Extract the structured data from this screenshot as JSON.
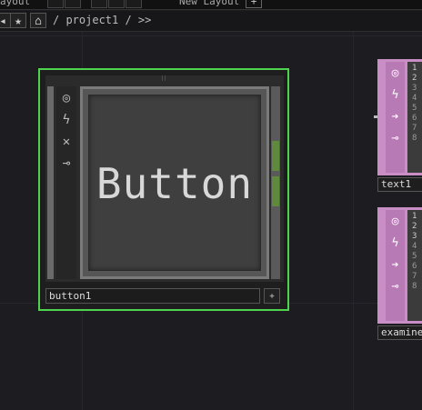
{
  "topbar": {
    "left_label": "ayout",
    "right_label": "New Layout",
    "add_label": "+"
  },
  "pathbar": {
    "back_glyph": "◂",
    "star_glyph": "★",
    "home_glyph": "⌂",
    "path": "/ project1 / >>"
  },
  "node_main": {
    "display_text": "Button",
    "name": "button1",
    "icons": [
      "viewer-toggle-icon",
      "cook-icon",
      "bypass-icon",
      "lock-icon"
    ]
  },
  "dat_text": {
    "name": "text1",
    "lines": [
      "1",
      "2",
      "3",
      "4",
      "5",
      "6",
      "7",
      "8"
    ]
  },
  "dat_examine": {
    "name": "examine",
    "lines": [
      "1",
      "2",
      "3",
      "4",
      "5",
      "6",
      "7",
      "8"
    ]
  }
}
